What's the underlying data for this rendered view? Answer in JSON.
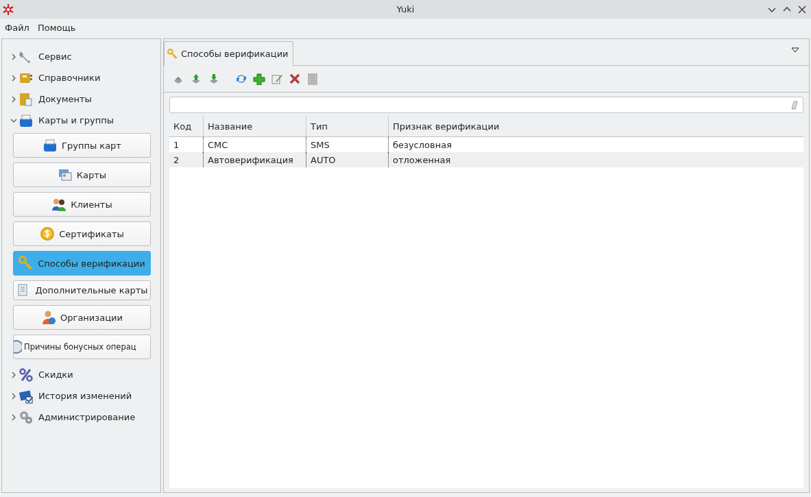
{
  "window": {
    "title": "Yuki"
  },
  "menu": [
    "Файл",
    "Помощь"
  ],
  "sidebar": {
    "groups": [
      {
        "label": "Сервис",
        "expanded": false
      },
      {
        "label": "Справочники",
        "expanded": false
      },
      {
        "label": "Документы",
        "expanded": false
      },
      {
        "label": "Карты и группы",
        "expanded": true,
        "items": [
          {
            "label": "Группы карт",
            "selected": false
          },
          {
            "label": "Карты",
            "selected": false
          },
          {
            "label": "Клиенты",
            "selected": false
          },
          {
            "label": "Сертификаты",
            "selected": false
          },
          {
            "label": "Способы верификации",
            "selected": true
          },
          {
            "label": "Дополнительные карты",
            "selected": false
          },
          {
            "label": "Организации",
            "selected": false
          },
          {
            "label": "Причины бонусных операц",
            "selected": false
          }
        ]
      },
      {
        "label": "Скидки",
        "expanded": false
      },
      {
        "label": "История изменений",
        "expanded": false
      },
      {
        "label": "Администрирование",
        "expanded": false
      }
    ]
  },
  "tabs": [
    {
      "label": "Способы верификации",
      "selected": true
    }
  ],
  "table": {
    "columns": [
      "Код",
      "Название",
      "Тип",
      "Признак верификации"
    ],
    "rows": [
      [
        "1",
        "СМС",
        "SMS",
        "безусловная"
      ],
      [
        "2",
        "Автоверификация",
        "AUTO",
        "отложенная"
      ]
    ]
  }
}
